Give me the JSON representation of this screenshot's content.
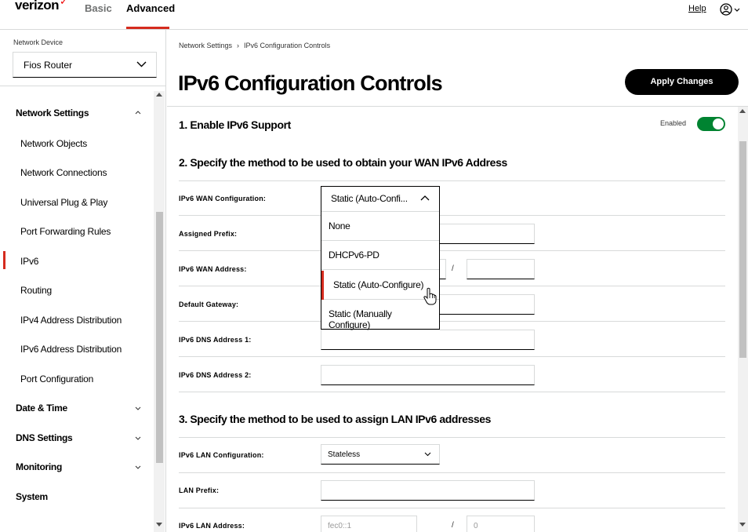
{
  "header": {
    "logo": "verizon",
    "tabs": [
      {
        "label": "Basic",
        "active": false
      },
      {
        "label": "Advanced",
        "active": true
      }
    ],
    "help_label": "Help",
    "accent_color": "#d52b1e"
  },
  "sidebar": {
    "device_label": "Network Device",
    "device_value": "Fios Router",
    "sections": [
      {
        "label": "Network Settings",
        "expanded": true
      },
      {
        "label": "Date & Time",
        "expanded": false
      },
      {
        "label": "DNS Settings",
        "expanded": false
      },
      {
        "label": "Monitoring",
        "expanded": false
      },
      {
        "label": "System",
        "expanded": false
      }
    ],
    "items": [
      {
        "label": "Network Objects"
      },
      {
        "label": "Network Connections"
      },
      {
        "label": "Universal Plug & Play"
      },
      {
        "label": "Port Forwarding Rules"
      },
      {
        "label": "IPv6",
        "active": true
      },
      {
        "label": "Routing"
      },
      {
        "label": "IPv4 Address Distribution"
      },
      {
        "label": "IPv6 Address Distribution"
      },
      {
        "label": "Port Configuration"
      }
    ]
  },
  "main": {
    "breadcrumb": [
      "Network Settings",
      "IPv6 Configuration Controls"
    ],
    "title": "IPv6 Configuration Controls",
    "apply_label": "Apply Changes",
    "section1": {
      "title": "1. Enable IPv6 Support",
      "toggle_label": "Enabled",
      "toggle_on": true,
      "toggle_color": "#008331"
    },
    "section2": {
      "title": "2. Specify the method to be used to obtain your WAN IPv6 Address",
      "wan_config_label": "IPv6 WAN Configuration:",
      "wan_config_value": "Static (Auto-Confi...",
      "assigned_prefix_label": "Assigned Prefix:",
      "wan_address_label": "IPv6 WAN Address:",
      "default_gateway_label": "Default Gateway:",
      "dns1_label": "IPv6 DNS Address 1:",
      "dns2_label": "IPv6 DNS Address 2:",
      "slash": "/"
    },
    "section3": {
      "title": "3. Specify the method to be used to assign LAN IPv6 addresses",
      "lan_config_label": "IPv6 LAN Configuration:",
      "lan_config_value": "Stateless",
      "lan_prefix_label": "LAN Prefix:",
      "lan_address_label": "IPv6 LAN Address:",
      "lan_address_placeholder": "fec0::1",
      "lan_prefix_len_placeholder": "0",
      "slash": "/"
    },
    "dropdown": {
      "options": [
        {
          "label": "None",
          "selected": false
        },
        {
          "label": "DHCPv6-PD",
          "selected": false
        },
        {
          "label": "Static (Auto-Configure)",
          "selected": true
        },
        {
          "label": "Static (Manually Configure)",
          "selected": false
        }
      ]
    }
  }
}
